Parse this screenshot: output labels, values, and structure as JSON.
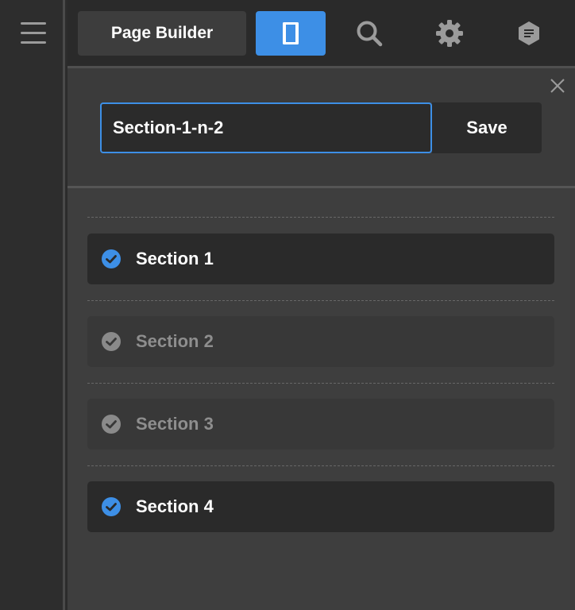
{
  "toolbar": {
    "page_builder_label": "Page Builder",
    "accent_color": "#3d8fe6"
  },
  "icons": {
    "menu": "hamburger-icon",
    "layout": "panel-layout-icon",
    "search": "search-icon",
    "settings": "gear-icon",
    "document": "document-icon",
    "close": "close-icon",
    "check": "check-circle-icon"
  },
  "editor": {
    "name_value": "Section-1-n-2",
    "save_label": "Save"
  },
  "sections": [
    {
      "label": "Section 1",
      "enabled": true
    },
    {
      "label": "Section 2",
      "enabled": false
    },
    {
      "label": "Section 3",
      "enabled": false
    },
    {
      "label": "Section 4",
      "enabled": true
    }
  ],
  "colors": {
    "enabled_check": "#3d8fe6",
    "disabled_check": "#8a8a8a"
  }
}
